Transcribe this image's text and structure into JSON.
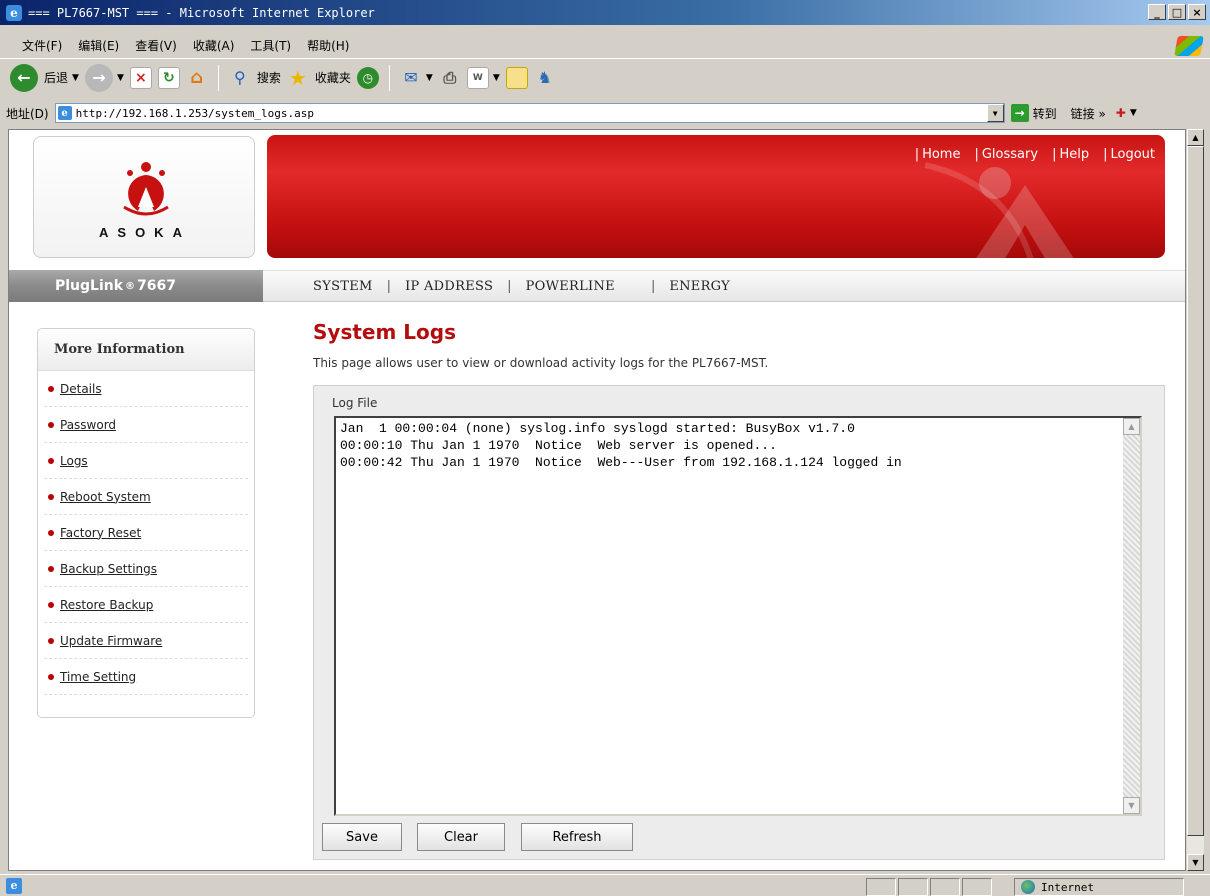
{
  "window": {
    "title": "=== PL7667-MST === - Microsoft Internet Explorer"
  },
  "menu": [
    "文件(F)",
    "编辑(E)",
    "查看(V)",
    "收藏(A)",
    "工具(T)",
    "帮助(H)"
  ],
  "toolbar": {
    "back": "后退",
    "search": "搜索",
    "favorites": "收藏夹"
  },
  "address": {
    "label": "地址(D)",
    "url": "http://192.168.1.253/system_logs.asp",
    "go": "转到",
    "links": "链接 »"
  },
  "header": {
    "logo_text": "ASOKA",
    "nav": [
      "Home",
      "Glossary",
      "Help",
      "Logout"
    ]
  },
  "brand": {
    "name": "PlugLink",
    "reg": "®",
    "model": "7667"
  },
  "mainnav": [
    "SYSTEM",
    "IP ADDRESS",
    "POWERLINE",
    "ENERGY"
  ],
  "sidebar": {
    "title": "More Information",
    "items": [
      "Details",
      "Password",
      "Logs",
      "Reboot System",
      "Factory Reset",
      "Backup Settings",
      "Restore Backup",
      "Update Firmware",
      "Time Setting"
    ]
  },
  "page": {
    "title": "System Logs",
    "description": "This page allows user to view or download activity logs for the PL7667-MST.",
    "log_label": "Log File",
    "log_lines": [
      "Jan  1 00:00:04 (none) syslog.info syslogd started: BusyBox v1.7.0",
      "00:00:10 Thu Jan 1 1970  Notice  Web server is opened...",
      "00:00:42 Thu Jan 1 1970  Notice  Web---User from 192.168.1.124 logged in"
    ],
    "buttons": {
      "save": "Save",
      "clear": "Clear",
      "refresh": "Refresh"
    }
  },
  "status": {
    "zone": "Internet"
  },
  "colors": {
    "brand_red": "#c91414",
    "title_red": "#b50d0d"
  }
}
